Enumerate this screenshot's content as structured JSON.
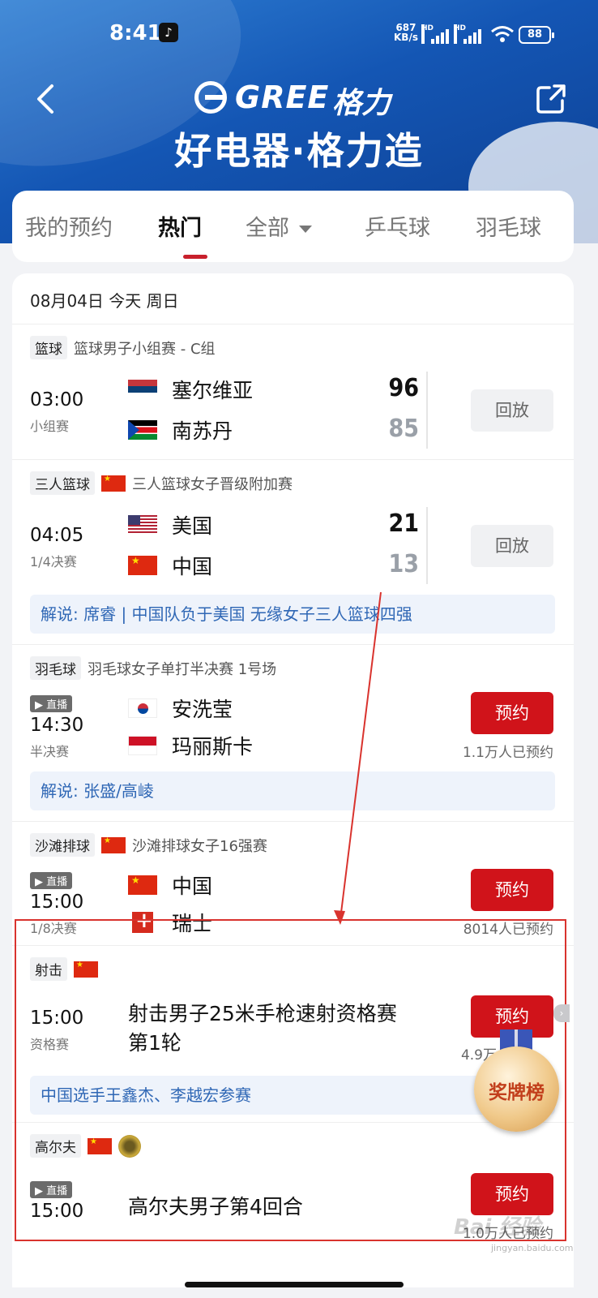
{
  "status_bar": {
    "time": "8:41",
    "net_speed_value": "687",
    "net_speed_unit": "KB/s",
    "signal_label": "HD",
    "battery": "88"
  },
  "header": {
    "brand_name": "GREE",
    "brand_cn": "格力",
    "slogan": "好电器·格力造"
  },
  "tabs": [
    {
      "label": "我的预约",
      "active": false
    },
    {
      "label": "热门",
      "active": true
    },
    {
      "label": "全部",
      "active": false,
      "has_dropdown": true
    },
    {
      "label": "乒乓球",
      "active": false
    },
    {
      "label": "羽毛球",
      "active": false
    }
  ],
  "date_label": "08月04日 今天 周日",
  "matches": [
    {
      "sport": "篮球",
      "title": "篮球男子小组赛 - C组",
      "time": "03:00",
      "round": "小组赛",
      "team1": "塞尔维亚",
      "team2": "南苏丹",
      "score1": "96",
      "score2": "85",
      "button": "回放"
    },
    {
      "sport": "三人篮球",
      "title": "三人篮球女子晋级附加赛",
      "time": "04:05",
      "round": "1/4决赛",
      "team1": "美国",
      "team2": "中国",
      "score1": "21",
      "score2": "13",
      "button": "回放",
      "commentary": "解说: 席睿 | 中国队负于美国 无缘女子三人篮球四强"
    },
    {
      "sport": "羽毛球",
      "title": "羽毛球女子单打半决赛 1号场",
      "live": "▶ 直播",
      "time": "14:30",
      "round": "半决赛",
      "team1": "安洗莹",
      "team2": "玛丽斯卡",
      "button": "预约",
      "reserve_count": "1.1万人已预约",
      "commentary": "解说: 张盛/高崚"
    },
    {
      "sport": "沙滩排球",
      "title": "沙滩排球女子16强赛",
      "live": "▶ 直播",
      "time": "15:00",
      "round": "1/8决赛",
      "team1": "中国",
      "team2": "瑞士",
      "button": "预约",
      "reserve_count": "8014人已预约"
    },
    {
      "sport": "射击",
      "time": "15:00",
      "round": "资格赛",
      "event_line1": "射击男子25米手枪速射资格赛",
      "event_line2": "第1轮",
      "button": "预约",
      "reserve_count": "4.9万",
      "commentary": "中国选手王鑫杰、李越宏参赛"
    },
    {
      "sport": "高尔夫",
      "live": "▶ 直播",
      "time": "15:00",
      "event_line1": "高尔夫男子第4回合",
      "button": "预约",
      "reserve_count": "1.0万人已预约"
    }
  ],
  "medal_badge": "奖牌榜",
  "watermark": "Bai 经验",
  "watermark_sub": "jingyan.baidu.com",
  "colors": {
    "accent_red": "#d0131a",
    "header_blue": "#1456b4",
    "commentary_blue": "#2f67b5",
    "annotation_red": "#d9332e"
  }
}
